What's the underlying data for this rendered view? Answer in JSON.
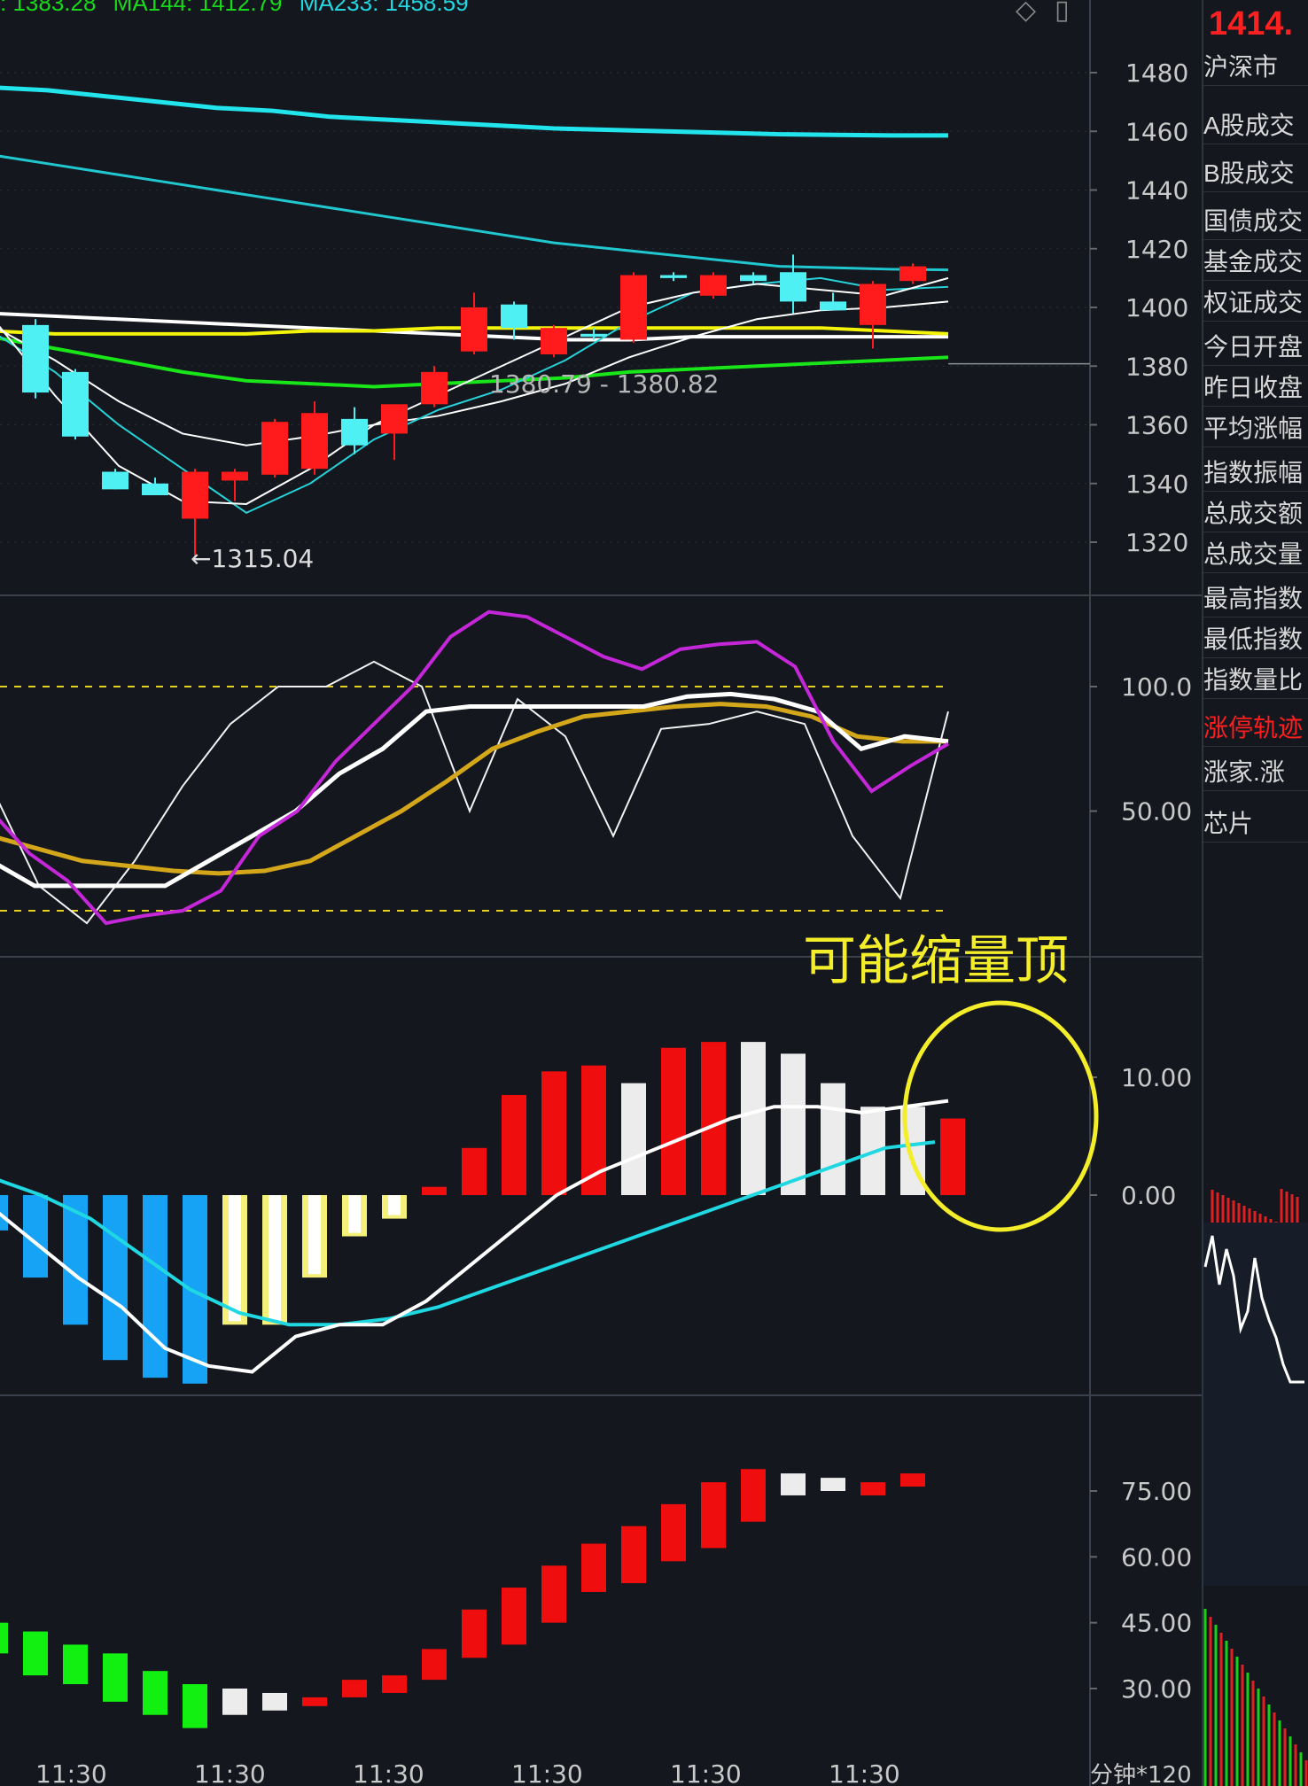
{
  "legend": {
    "ma_a": ": 1383.28",
    "ma_b": "MA144: 1412.79",
    "ma_c": "MA233: 1458.59",
    "colors": {
      "ma_a": "#18d81a",
      "ma_b": "#18d81a",
      "ma_c": "#22d7e0"
    }
  },
  "toolbar_icons": [
    "diamond-icon",
    "panel-toggle-icon"
  ],
  "price_axis": {
    "ticks": [
      "1480",
      "1460",
      "1440",
      "1420",
      "1400",
      "1380",
      "1360",
      "1340",
      "1320"
    ],
    "values": [
      1480,
      1460,
      1440,
      1420,
      1400,
      1380,
      1360,
      1340,
      1320
    ]
  },
  "price_annotations": {
    "low_label": "←1315.04",
    "range_label": "1380.79 - 1380.82"
  },
  "osc_axis": {
    "ticks": [
      "100.0",
      "50.00"
    ]
  },
  "macd_axis": {
    "ticks": [
      "10.00",
      "0.00"
    ]
  },
  "vol_axis": {
    "ticks": [
      "75.00",
      "60.00",
      "45.00",
      "30.00"
    ]
  },
  "time_axis": {
    "labels": [
      "11:30",
      "11:30",
      "11:30",
      "11:30",
      "11:30",
      "11:30"
    ],
    "period": "分钟*120"
  },
  "annotation_text": "可能缩量顶",
  "side_panel": {
    "price": "1414.",
    "rows": [
      {
        "label": "沪深市",
        "red": false
      },
      {
        "label": "A股成交",
        "red": false
      },
      {
        "label": "B股成交",
        "red": false
      },
      {
        "label": "国债成交",
        "red": false
      },
      {
        "label": "基金成交",
        "red": false
      },
      {
        "label": "权证成交",
        "red": false
      },
      {
        "label": "今日开盘",
        "red": false
      },
      {
        "label": "昨日收盘",
        "red": false
      },
      {
        "label": "平均涨幅",
        "red": false
      },
      {
        "label": "指数振幅",
        "red": false
      },
      {
        "label": "总成交额",
        "red": false
      },
      {
        "label": "总成交量",
        "red": false
      },
      {
        "label": "最高指数",
        "red": false
      },
      {
        "label": "最低指数",
        "red": false
      },
      {
        "label": "指数量比",
        "red": false
      },
      {
        "label": "涨停轨迹",
        "red": true
      },
      {
        "label": "涨家.涨",
        "red": false
      },
      {
        "label": "芯片",
        "red": false
      }
    ]
  },
  "chart_data": [
    {
      "type": "candlestick",
      "title": "",
      "ylim": [
        1310,
        1490
      ],
      "candles": [
        {
          "o": 1394,
          "h": 1396,
          "l": 1369,
          "c": 1371,
          "up": false
        },
        {
          "o": 1378,
          "h": 1379,
          "l": 1355,
          "c": 1356,
          "up": false
        },
        {
          "o": 1344,
          "h": 1345,
          "l": 1338,
          "c": 1338,
          "up": false
        },
        {
          "o": 1340,
          "h": 1342,
          "l": 1336,
          "c": 1336,
          "up": false
        },
        {
          "o": 1328,
          "h": 1345,
          "l": 1315.04,
          "c": 1344,
          "up": true
        },
        {
          "o": 1341,
          "h": 1345,
          "l": 1334,
          "c": 1344,
          "up": true
        },
        {
          "o": 1343,
          "h": 1362,
          "l": 1342,
          "c": 1361,
          "up": true
        },
        {
          "o": 1345,
          "h": 1368,
          "l": 1343,
          "c": 1364,
          "up": true
        },
        {
          "o": 1362,
          "h": 1366,
          "l": 1350,
          "c": 1353,
          "up": false
        },
        {
          "o": 1357,
          "h": 1367,
          "l": 1348,
          "c": 1367,
          "up": true
        },
        {
          "o": 1367,
          "h": 1380,
          "l": 1366,
          "c": 1378,
          "up": true
        },
        {
          "o": 1385,
          "h": 1405,
          "l": 1384,
          "c": 1400,
          "up": true
        },
        {
          "o": 1401,
          "h": 1402,
          "l": 1389,
          "c": 1393,
          "up": false
        },
        {
          "o": 1384,
          "h": 1394,
          "l": 1383,
          "c": 1393,
          "up": true
        },
        {
          "o": 1390,
          "h": 1393,
          "l": 1389,
          "c": 1391,
          "up": false
        },
        {
          "o": 1389,
          "h": 1412,
          "l": 1388,
          "c": 1411,
          "up": true
        },
        {
          "o": 1411,
          "h": 1412,
          "l": 1409,
          "c": 1410,
          "up": false
        },
        {
          "o": 1404,
          "h": 1412,
          "l": 1403,
          "c": 1411,
          "up": true
        },
        {
          "o": 1411,
          "h": 1412,
          "l": 1408,
          "c": 1409,
          "up": false
        },
        {
          "o": 1412,
          "h": 1418,
          "l": 1398,
          "c": 1402,
          "up": false
        },
        {
          "o": 1402,
          "h": 1405,
          "l": 1399,
          "c": 1399,
          "up": false
        },
        {
          "o": 1394,
          "h": 1409,
          "l": 1386,
          "c": 1408,
          "up": true
        },
        {
          "o": 1409,
          "h": 1415,
          "l": 1408,
          "c": 1414,
          "up": true
        }
      ],
      "ma_lines": [
        {
          "name": "MA233",
          "color": "#22e4ec",
          "values": [
            1475,
            1474,
            1472,
            1470,
            1468,
            1467,
            1465,
            1464,
            1463,
            1462,
            1461,
            1460.5,
            1460,
            1459.5,
            1459,
            1458.8,
            1458.6,
            1458.59
          ]
        },
        {
          "name": "MA144",
          "color": "#21c7cf",
          "values": [
            1452,
            1449,
            1446,
            1443,
            1440,
            1437,
            1434,
            1431,
            1428,
            1425,
            1422,
            1420,
            1418,
            1416,
            1414,
            1413.5,
            1413,
            1412.79
          ]
        }
      ]
    },
    {
      "type": "line",
      "title": "",
      "ylim": [
        -20,
        130
      ],
      "ref_lines": [
        100,
        10
      ],
      "series_values": {
        "purple": [
          50,
          33,
          22,
          5,
          8,
          10,
          18,
          40,
          50,
          70,
          85,
          100,
          120,
          130,
          128,
          120,
          112,
          107,
          115,
          117,
          118,
          108,
          78,
          58,
          68,
          77
        ],
        "white_bold": [
          30,
          20,
          20,
          20,
          20,
          30,
          40,
          50,
          65,
          75,
          90,
          92,
          92,
          92,
          92,
          92,
          96,
          97,
          95,
          90,
          75,
          80,
          78
        ],
        "gold": [
          40,
          35,
          30,
          28,
          26,
          25,
          26,
          30,
          40,
          50,
          62,
          75,
          82,
          88,
          90,
          92,
          93,
          92,
          88,
          80,
          78,
          78
        ],
        "white_thin": [
          60,
          20,
          5,
          30,
          60,
          85,
          100,
          100,
          110,
          100,
          50,
          95,
          80,
          40,
          83,
          85,
          90,
          85,
          40,
          15,
          90
        ]
      }
    },
    {
      "type": "bar",
      "title": "",
      "ylim": [
        -16,
        16
      ],
      "values": [
        -3,
        -7,
        -11,
        -14,
        -15.5,
        -16,
        -11,
        -11,
        -7,
        -3.5,
        -2,
        0.7,
        4,
        8.5,
        10.5,
        11,
        9.5,
        12.5,
        13,
        13,
        12,
        9.5,
        7.5,
        7.5,
        6.5
      ],
      "bar_colors": [
        "blue",
        "blue",
        "blue",
        "blue",
        "blue",
        "blue",
        "yellow",
        "yellow",
        "yellow",
        "yellow",
        "yellow",
        "red",
        "red",
        "red",
        "red",
        "red",
        "white",
        "red",
        "red",
        "white",
        "white",
        "white",
        "white",
        "white",
        "red"
      ],
      "dif": [
        -1,
        -4,
        -7,
        -9.5,
        -13,
        -14.5,
        -15,
        -12,
        -11,
        -11,
        -9,
        -6,
        -3,
        0,
        2,
        3.5,
        5,
        6.5,
        7.5,
        7.5,
        7,
        7.5,
        8
      ],
      "dea": [
        1.5,
        0,
        -2,
        -5,
        -8,
        -10,
        -11,
        -11,
        -10.5,
        -9.5,
        -8,
        -6.5,
        -5,
        -3.5,
        -2,
        -0.5,
        1,
        2.5,
        4,
        4.5
      ]
    },
    {
      "type": "bar",
      "title": "",
      "ylim": [
        20,
        90
      ],
      "floating": [
        {
          "lo": 45,
          "hi": 38,
          "c": "green"
        },
        {
          "lo": 43,
          "hi": 33,
          "c": "green"
        },
        {
          "lo": 40,
          "hi": 31,
          "c": "green"
        },
        {
          "lo": 38,
          "hi": 27,
          "c": "green"
        },
        {
          "lo": 34,
          "hi": 24,
          "c": "green"
        },
        {
          "lo": 31,
          "hi": 21,
          "c": "green"
        },
        {
          "lo": 30,
          "hi": 24,
          "c": "white"
        },
        {
          "lo": 29,
          "hi": 25,
          "c": "white"
        },
        {
          "lo": 28,
          "hi": 26,
          "c": "red"
        },
        {
          "lo": 32,
          "hi": 28,
          "c": "red"
        },
        {
          "lo": 33,
          "hi": 29,
          "c": "red"
        },
        {
          "lo": 39,
          "hi": 32,
          "c": "red"
        },
        {
          "lo": 48,
          "hi": 37,
          "c": "red"
        },
        {
          "lo": 53,
          "hi": 40,
          "c": "red"
        },
        {
          "lo": 58,
          "hi": 45,
          "c": "red"
        },
        {
          "lo": 63,
          "hi": 52,
          "c": "red"
        },
        {
          "lo": 67,
          "hi": 54,
          "c": "red"
        },
        {
          "lo": 72,
          "hi": 59,
          "c": "red"
        },
        {
          "lo": 77,
          "hi": 62,
          "c": "red"
        },
        {
          "lo": 80,
          "hi": 68,
          "c": "red"
        },
        {
          "lo": 79,
          "hi": 74,
          "c": "white"
        },
        {
          "lo": 78,
          "hi": 75,
          "c": "white"
        },
        {
          "lo": 77,
          "hi": 74,
          "c": "red"
        },
        {
          "lo": 79,
          "hi": 76,
          "c": "red"
        }
      ]
    }
  ]
}
